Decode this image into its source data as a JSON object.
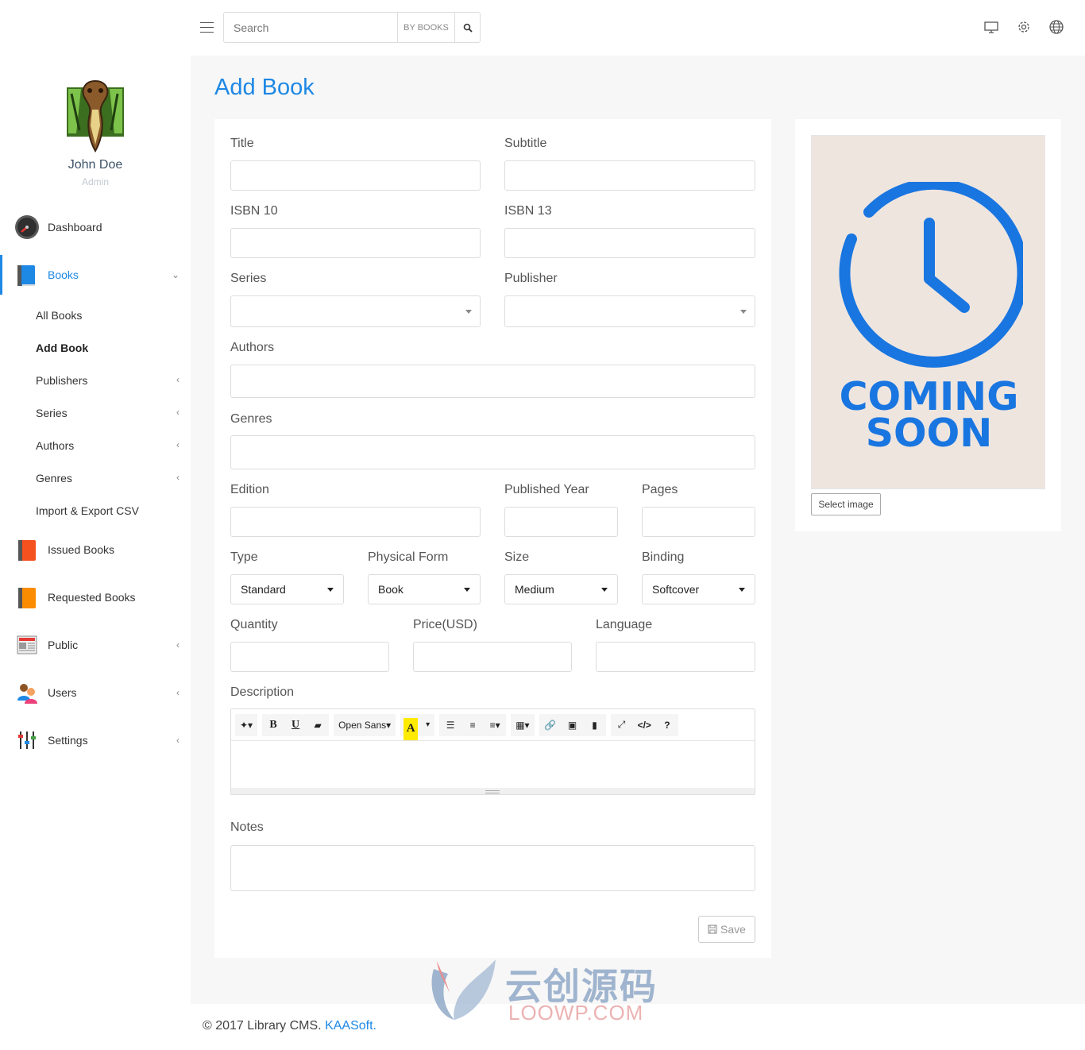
{
  "user": {
    "name": "John Doe",
    "role": "Admin"
  },
  "nav": {
    "dashboard": "Dashboard",
    "books": "Books",
    "books_sub": [
      "All Books",
      "Add Book",
      "Publishers",
      "Series",
      "Authors",
      "Genres",
      "Import & Export CSV"
    ],
    "issued": "Issued Books",
    "requested": "Requested Books",
    "public": "Public",
    "users": "Users",
    "settings": "Settings"
  },
  "search": {
    "placeholder": "Search",
    "by": "BY BOOKS"
  },
  "page": {
    "title": "Add Book"
  },
  "form": {
    "title_label": "Title",
    "subtitle_label": "Subtitle",
    "isbn10_label": "ISBN 10",
    "isbn13_label": "ISBN 13",
    "series_label": "Series",
    "publisher_label": "Publisher",
    "authors_label": "Authors",
    "genres_label": "Genres",
    "edition_label": "Edition",
    "published_year_label": "Published Year",
    "pages_label": "Pages",
    "type_label": "Type",
    "type_value": "Standard",
    "physical_form_label": "Physical Form",
    "physical_form_value": "Book",
    "size_label": "Size",
    "size_value": "Medium",
    "binding_label": "Binding",
    "binding_value": "Softcover",
    "quantity_label": "Quantity",
    "price_label": "Price(USD)",
    "language_label": "Language",
    "description_label": "Description",
    "font_family": "Open Sans",
    "notes_label": "Notes",
    "save_label": "Save"
  },
  "cover": {
    "line1": "COMING",
    "line2": "SOON",
    "select_label": "Select image"
  },
  "footer": {
    "text": "© 2017 Library CMS. ",
    "link": "KAASoft."
  },
  "watermark": {
    "cn": "云创源码",
    "en": "LOOWP.COM"
  },
  "colors": {
    "accent": "#1e88e5",
    "coming_soon": "#1976e0",
    "cover_bg": "#efe5df"
  }
}
